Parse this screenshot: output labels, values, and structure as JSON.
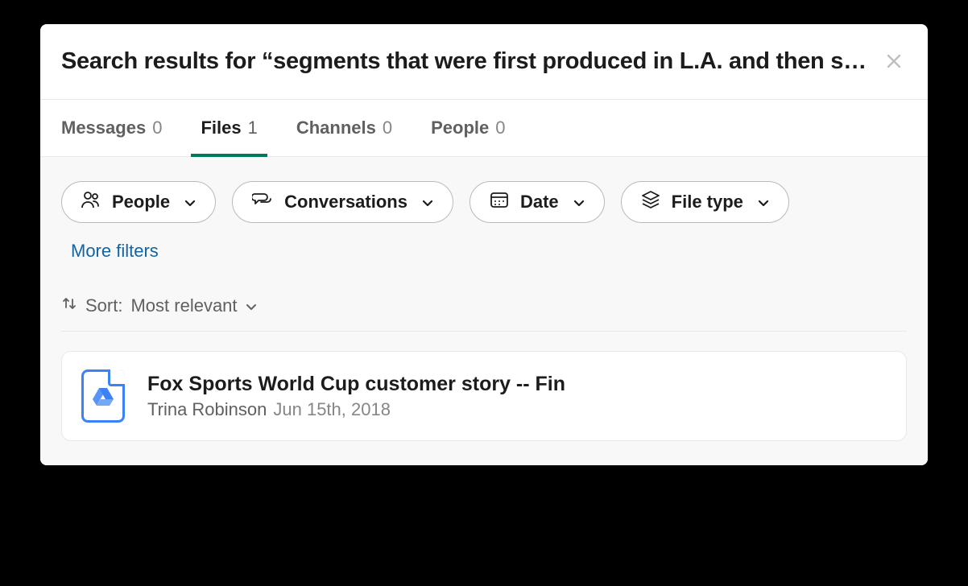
{
  "header": {
    "title": "Search results for “segments that were first produced in L.A. and then shipped…"
  },
  "tabs": [
    {
      "label": "Messages",
      "count": "0",
      "active": false
    },
    {
      "label": "Files",
      "count": "1",
      "active": true
    },
    {
      "label": "Channels",
      "count": "0",
      "active": false
    },
    {
      "label": "People",
      "count": "0",
      "active": false
    }
  ],
  "filters": {
    "people": "People",
    "conversations": "Conversations",
    "date": "Date",
    "filetype": "File type",
    "more": "More filters"
  },
  "sort": {
    "prefix": "Sort:",
    "value": "Most relevant"
  },
  "results": [
    {
      "title": "Fox Sports World Cup customer story -- Fin",
      "author": "Trina Robinson",
      "date": "Jun 15th, 2018"
    }
  ]
}
